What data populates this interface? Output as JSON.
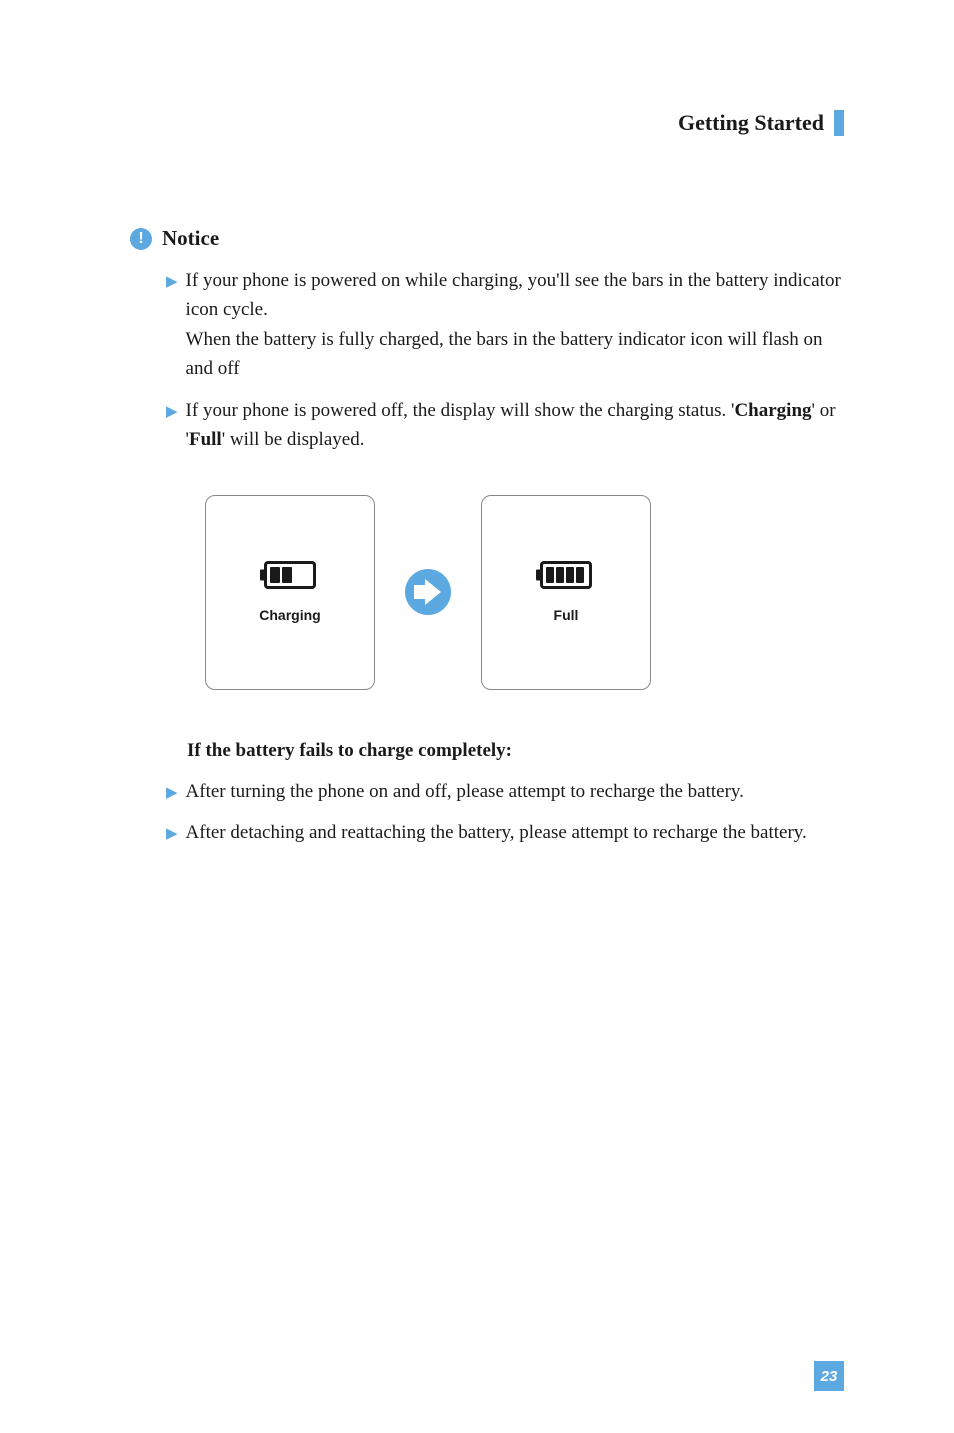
{
  "header": {
    "title": "Getting Started"
  },
  "notice": {
    "label": "Notice",
    "items": [
      {
        "line1": "If your phone is powered on while charging, you'll see the bars in the battery indicator icon cycle.",
        "line2": "When the battery is fully charged, the bars in the battery indicator icon will flash on and off"
      },
      {
        "line1_prefix": "If your phone is powered off, the display will show the charging status. '",
        "bold1": "Charging",
        "mid": "' or '",
        "bold2": "Full",
        "suffix": "' will be displayed."
      }
    ]
  },
  "diagram": {
    "screen1_label": "Charging",
    "screen2_label": "Full"
  },
  "troubleshoot": {
    "heading": "If the battery fails to charge completely:",
    "items": [
      "After turning the phone on and off, please attempt to recharge the battery.",
      "After detaching and reattaching the battery, please attempt to recharge the battery."
    ]
  },
  "page_number": "23"
}
